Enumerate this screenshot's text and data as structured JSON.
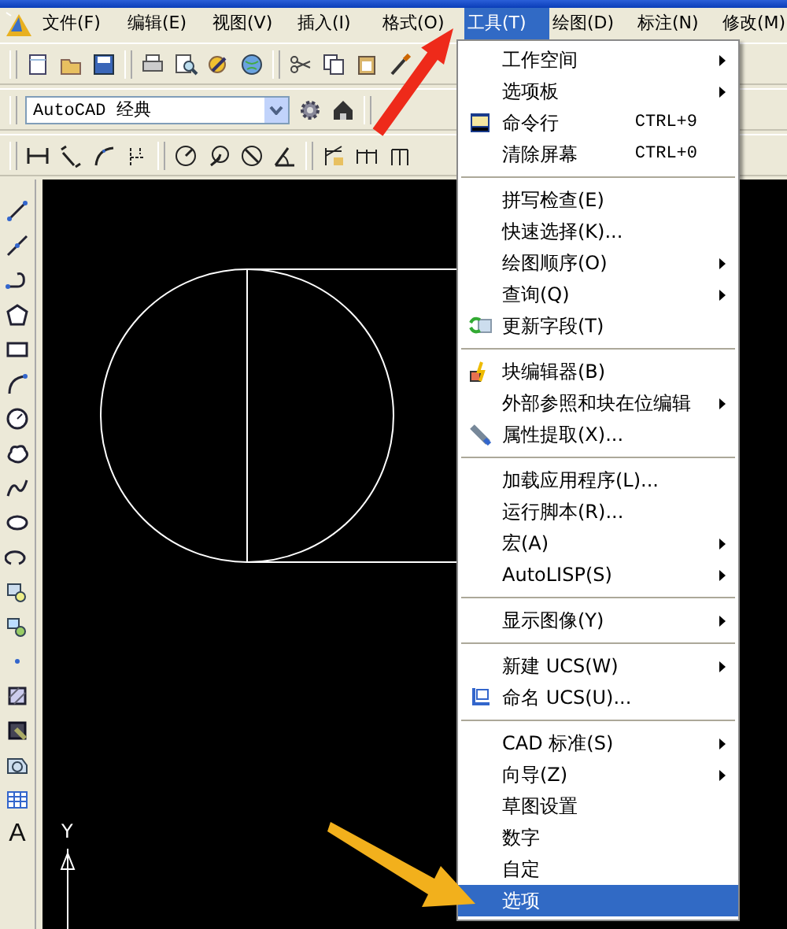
{
  "menubar": [
    {
      "label": "文件(F)",
      "selected": false
    },
    {
      "label": "编辑(E)",
      "selected": false
    },
    {
      "label": "视图(V)",
      "selected": false
    },
    {
      "label": "插入(I)",
      "selected": false
    },
    {
      "label": "格式(O)",
      "selected": false
    },
    {
      "label": "工具(T)",
      "selected": true
    },
    {
      "label": "绘图(D)",
      "selected": false
    },
    {
      "label": "标注(N)",
      "selected": false
    },
    {
      "label": "修改(M)",
      "selected": false
    }
  ],
  "workspace_combo": {
    "value": "AutoCAD 经典"
  },
  "draw_toolbar": {
    "text_tool": "A"
  },
  "canvas": {
    "ucs_label": "Y"
  },
  "tools_menu": [
    {
      "kind": "item",
      "label": "工作空间",
      "submenu": true,
      "selected": false
    },
    {
      "kind": "item",
      "label": "选项板",
      "submenu": true,
      "selected": false
    },
    {
      "kind": "item",
      "label": "命令行",
      "shortcut": "CTRL+9",
      "selected": false
    },
    {
      "kind": "item",
      "label": "清除屏幕",
      "shortcut": "CTRL+0",
      "selected": false
    },
    {
      "kind": "separator"
    },
    {
      "kind": "item",
      "label": "拼写检查(E)",
      "selected": false
    },
    {
      "kind": "item",
      "label": "快速选择(K)...",
      "selected": false
    },
    {
      "kind": "item",
      "label": "绘图顺序(O)",
      "submenu": true,
      "selected": false
    },
    {
      "kind": "item",
      "label": "查询(Q)",
      "submenu": true,
      "selected": false
    },
    {
      "kind": "item",
      "label": "更新字段(T)",
      "selected": false
    },
    {
      "kind": "separator"
    },
    {
      "kind": "item",
      "label": "块编辑器(B)",
      "selected": false
    },
    {
      "kind": "item",
      "label": "外部参照和块在位编辑",
      "submenu": true,
      "selected": false
    },
    {
      "kind": "item",
      "label": "属性提取(X)...",
      "selected": false
    },
    {
      "kind": "separator"
    },
    {
      "kind": "item",
      "label": "加载应用程序(L)...",
      "selected": false
    },
    {
      "kind": "item",
      "label": "运行脚本(R)...",
      "selected": false
    },
    {
      "kind": "item",
      "label": "宏(A)",
      "submenu": true,
      "selected": false
    },
    {
      "kind": "item",
      "label": "AutoLISP(S)",
      "submenu": true,
      "selected": false
    },
    {
      "kind": "separator"
    },
    {
      "kind": "item",
      "label": "显示图像(Y)",
      "submenu": true,
      "selected": false
    },
    {
      "kind": "separator"
    },
    {
      "kind": "item",
      "label": "新建 UCS(W)",
      "submenu": true,
      "selected": false
    },
    {
      "kind": "item",
      "label": "命名 UCS(U)...",
      "selected": false
    },
    {
      "kind": "separator"
    },
    {
      "kind": "item",
      "label": "CAD 标准(S)",
      "submenu": true,
      "selected": false
    },
    {
      "kind": "item",
      "label": "向导(Z)",
      "submenu": true,
      "selected": false
    },
    {
      "kind": "item",
      "label": "草图设置",
      "selected": false
    },
    {
      "kind": "item",
      "label": "数字",
      "selected": false
    },
    {
      "kind": "item",
      "label": "自定",
      "selected": false
    },
    {
      "kind": "item",
      "label": "选项",
      "selected": true
    }
  ]
}
